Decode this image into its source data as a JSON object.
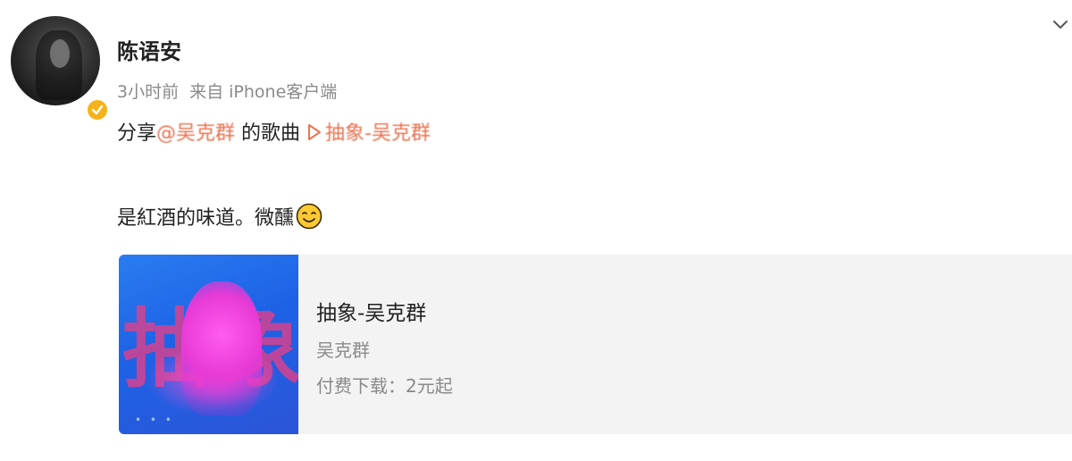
{
  "post": {
    "author": "陈语安",
    "time": "3小时前",
    "source": "来自 iPhone客户端",
    "line1_prefix": "分享",
    "mention": "@吴克群",
    "line1_middle": " 的歌曲",
    "song_link": "抽象-吴克群",
    "line2": "是紅酒的味道。微醺"
  },
  "music_card": {
    "title": "抽象-吴克群",
    "artist": "吴克群",
    "price": "付费下载：2元起",
    "cover_text": "抽象"
  },
  "colors": {
    "link": "#eb7350",
    "verified": "#f5b319",
    "meta": "#8a8a8a"
  },
  "icons": [
    "verified-icon",
    "chevron-down-icon",
    "play-icon",
    "smile-emoji-icon"
  ]
}
